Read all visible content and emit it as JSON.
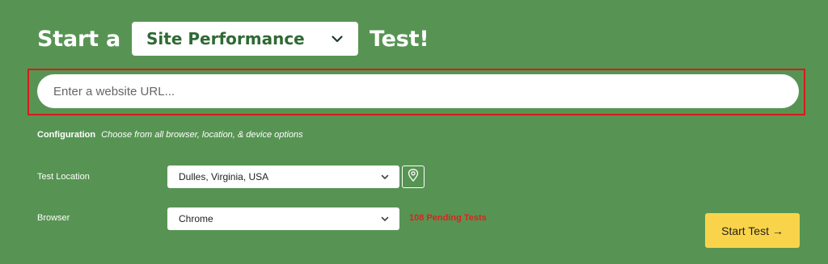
{
  "headline": {
    "prefix": "Start a",
    "suffix": "Test!",
    "test_type": {
      "selected": "Site Performance",
      "icon": "chevron-down-icon"
    }
  },
  "url_input": {
    "placeholder": "Enter a website URL...",
    "value": ""
  },
  "configuration": {
    "label": "Configuration",
    "description": "Choose from all browser, location, & device options"
  },
  "test_location": {
    "label": "Test Location",
    "selected": "Dulles, Virginia, USA",
    "map_button_icon": "map-pin-icon"
  },
  "browser": {
    "label": "Browser",
    "selected": "Chrome",
    "pending_text": "108 Pending Tests"
  },
  "start_button": {
    "label": "Start Test →"
  },
  "colors": {
    "background": "#579453",
    "highlight_border": "#d81a1a",
    "select_text": "#2f6a34",
    "pending_text": "#e0201f",
    "start_button": "#f9d44a"
  }
}
